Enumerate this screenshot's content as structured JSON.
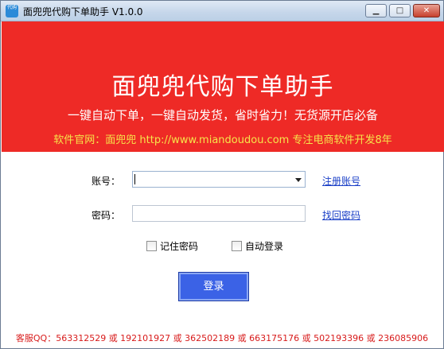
{
  "window": {
    "title": "面兜兜代购下单助手 V1.0.0",
    "icon_text": "代购",
    "buttons": {
      "minimize": "▁",
      "maximize": "□",
      "close": "✕"
    }
  },
  "banner": {
    "title": "面兜兜代购下单助手",
    "slogan": "一键自动下单，一键自动发货，省时省力！无货源开店必备",
    "site": "软件官网：面兜兜 http://www.miandoudou.com 专注电商软件开发8年"
  },
  "form": {
    "account_label": "账号：",
    "account_value": "",
    "password_label": "密码：",
    "password_value": "",
    "register_link": "注册账号",
    "recover_link": "找回密码",
    "remember_label": "记住密码",
    "auto_login_label": "自动登录",
    "login_button": "登录"
  },
  "footer": "客服QQ：563312529 或 192101927 或 362502189 或 663175176 或 502193396 或 236085906",
  "colors": {
    "banner": "#ee2a26",
    "site_text": "#f6e44a",
    "link": "#1a3fc7",
    "login": "#3b62e6",
    "footer": "#d81b1b"
  }
}
